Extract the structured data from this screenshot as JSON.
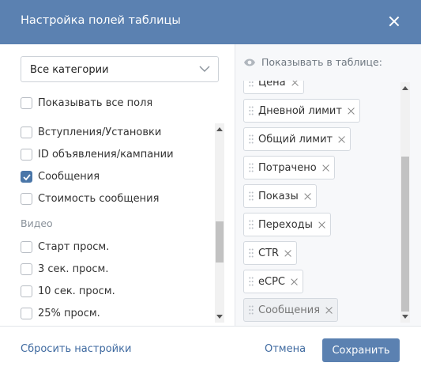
{
  "dialog": {
    "title": "Настройка полей таблицы",
    "close_icon": "close-icon"
  },
  "category_select": {
    "value": "Все категории",
    "icon": "chevron-down-icon"
  },
  "show_all": {
    "label": "Показывать все поля",
    "checked": false
  },
  "fields": [
    {
      "label": "Вступления/Установки",
      "checked": false
    },
    {
      "label": "ID объявления/кампании",
      "checked": false
    },
    {
      "label": "Сообщения",
      "checked": true
    },
    {
      "label": "Стоимость сообщения",
      "checked": false
    }
  ],
  "video_group": {
    "label": "Видео",
    "items": [
      {
        "label": "Старт просм.",
        "checked": false
      },
      {
        "label": "3 сек. просм.",
        "checked": false
      },
      {
        "label": "10 сек. просм.",
        "checked": false
      },
      {
        "label": "25% просм.",
        "checked": false
      }
    ]
  },
  "shown_panel": {
    "heading": "Показывать в таблице:",
    "icon": "eye-icon",
    "chips": [
      {
        "label": "Цена",
        "grey": false
      },
      {
        "label": "Дневной лимит",
        "grey": false
      },
      {
        "label": "Общий лимит",
        "grey": false
      },
      {
        "label": "Потрачено",
        "grey": false
      },
      {
        "label": "Показы",
        "grey": false
      },
      {
        "label": "Переходы",
        "grey": false
      },
      {
        "label": "CTR",
        "grey": false
      },
      {
        "label": "eCPC",
        "grey": false
      },
      {
        "label": "Сообщения",
        "grey": true
      }
    ]
  },
  "footer": {
    "reset_label": "Сбросить настройки",
    "cancel_label": "Отмена",
    "save_label": "Сохранить"
  },
  "colors": {
    "header": "#5b81b1",
    "accent": "#4a76a8",
    "link": "#3f6aa0"
  }
}
